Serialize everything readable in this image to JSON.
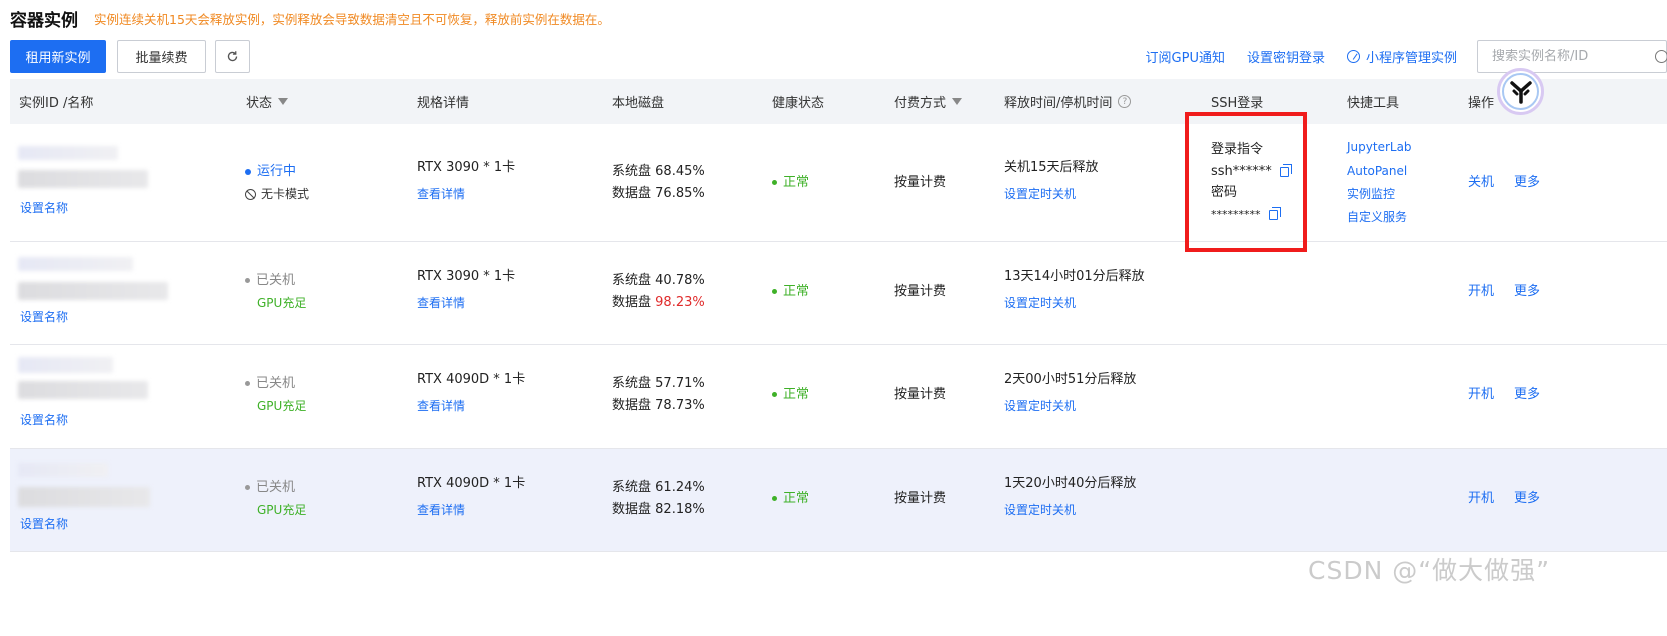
{
  "header": {
    "title": "容器实例",
    "warning": "实例连续关机15天会释放实例，实例释放会导致数据清空且不可恢复，释放前实例在数据在。"
  },
  "toolbar": {
    "rent_label": "租用新实例",
    "renew_label": "批量续费",
    "refresh_icon": "refresh-icon"
  },
  "tools": {
    "gpu_notify": "订阅GPU通知",
    "ssh_key": "设置密钥登录",
    "miniprogram": "小程序管理实例",
    "search_placeholder": "搜索实例名称/ID"
  },
  "columns": {
    "id": "实例ID /名称",
    "status": "状态",
    "spec": "规格详情",
    "disk": "本地磁盘",
    "health": "健康状态",
    "pay": "付费方式",
    "release": "释放时间/停机时间",
    "ssh": "SSH登录",
    "tools": "快捷工具",
    "ops": "操作"
  },
  "rows": [
    {
      "set_name": "设置名称",
      "status": "运行中",
      "status_sub": "无卡模式",
      "spec": "RTX 3090 * 1卡",
      "spec_link": "查看详情",
      "disk_sys_label": "系统盘",
      "disk_sys": "68.45%",
      "disk_data_label": "数据盘",
      "disk_data": "76.85%",
      "health": "正常",
      "pay": "按量计费",
      "release": "关机15天后释放",
      "release_link": "设置定时关机",
      "ssh_cmd_label": "登录指令",
      "ssh_cmd": "ssh******",
      "ssh_pwd_label": "密码",
      "ssh_pwd": "*********",
      "tools": [
        "JupyterLab",
        "AutoPanel",
        "实例监控",
        "自定义服务"
      ],
      "op_power": "关机",
      "op_more": "更多"
    },
    {
      "set_name": "设置名称",
      "status": "已关机",
      "status_sub": "GPU充足",
      "spec": "RTX 3090 * 1卡",
      "spec_link": "查看详情",
      "disk_sys_label": "系统盘",
      "disk_sys": "40.78%",
      "disk_data_label": "数据盘",
      "disk_data": "98.23%",
      "health": "正常",
      "pay": "按量计费",
      "release": "13天14小时01分后释放",
      "release_link": "设置定时关机",
      "op_power": "开机",
      "op_more": "更多"
    },
    {
      "set_name": "设置名称",
      "status": "已关机",
      "status_sub": "GPU充足",
      "spec": "RTX 4090D * 1卡",
      "spec_link": "查看详情",
      "disk_sys_label": "系统盘",
      "disk_sys": "57.71%",
      "disk_data_label": "数据盘",
      "disk_data": "78.73%",
      "health": "正常",
      "pay": "按量计费",
      "release": "2天00小时51分后释放",
      "release_link": "设置定时关机",
      "op_power": "开机",
      "op_more": "更多"
    },
    {
      "set_name": "设置名称",
      "status": "已关机",
      "status_sub": "GPU充足",
      "spec": "RTX 4090D * 1卡",
      "spec_link": "查看详情",
      "disk_sys_label": "系统盘",
      "disk_sys": "61.24%",
      "disk_data_label": "数据盘",
      "disk_data": "82.18%",
      "health": "正常",
      "pay": "按量计费",
      "release": "1天20小时40分后释放",
      "release_link": "设置定时关机",
      "op_power": "开机",
      "op_more": "更多"
    }
  ],
  "watermark": "CSDN @“做大做强”",
  "colors": {
    "primary": "#1d6ef2",
    "warning": "#f08a24",
    "success": "#3fb128",
    "danger": "#e02b2b",
    "annotation_box": "#f01c1c"
  }
}
